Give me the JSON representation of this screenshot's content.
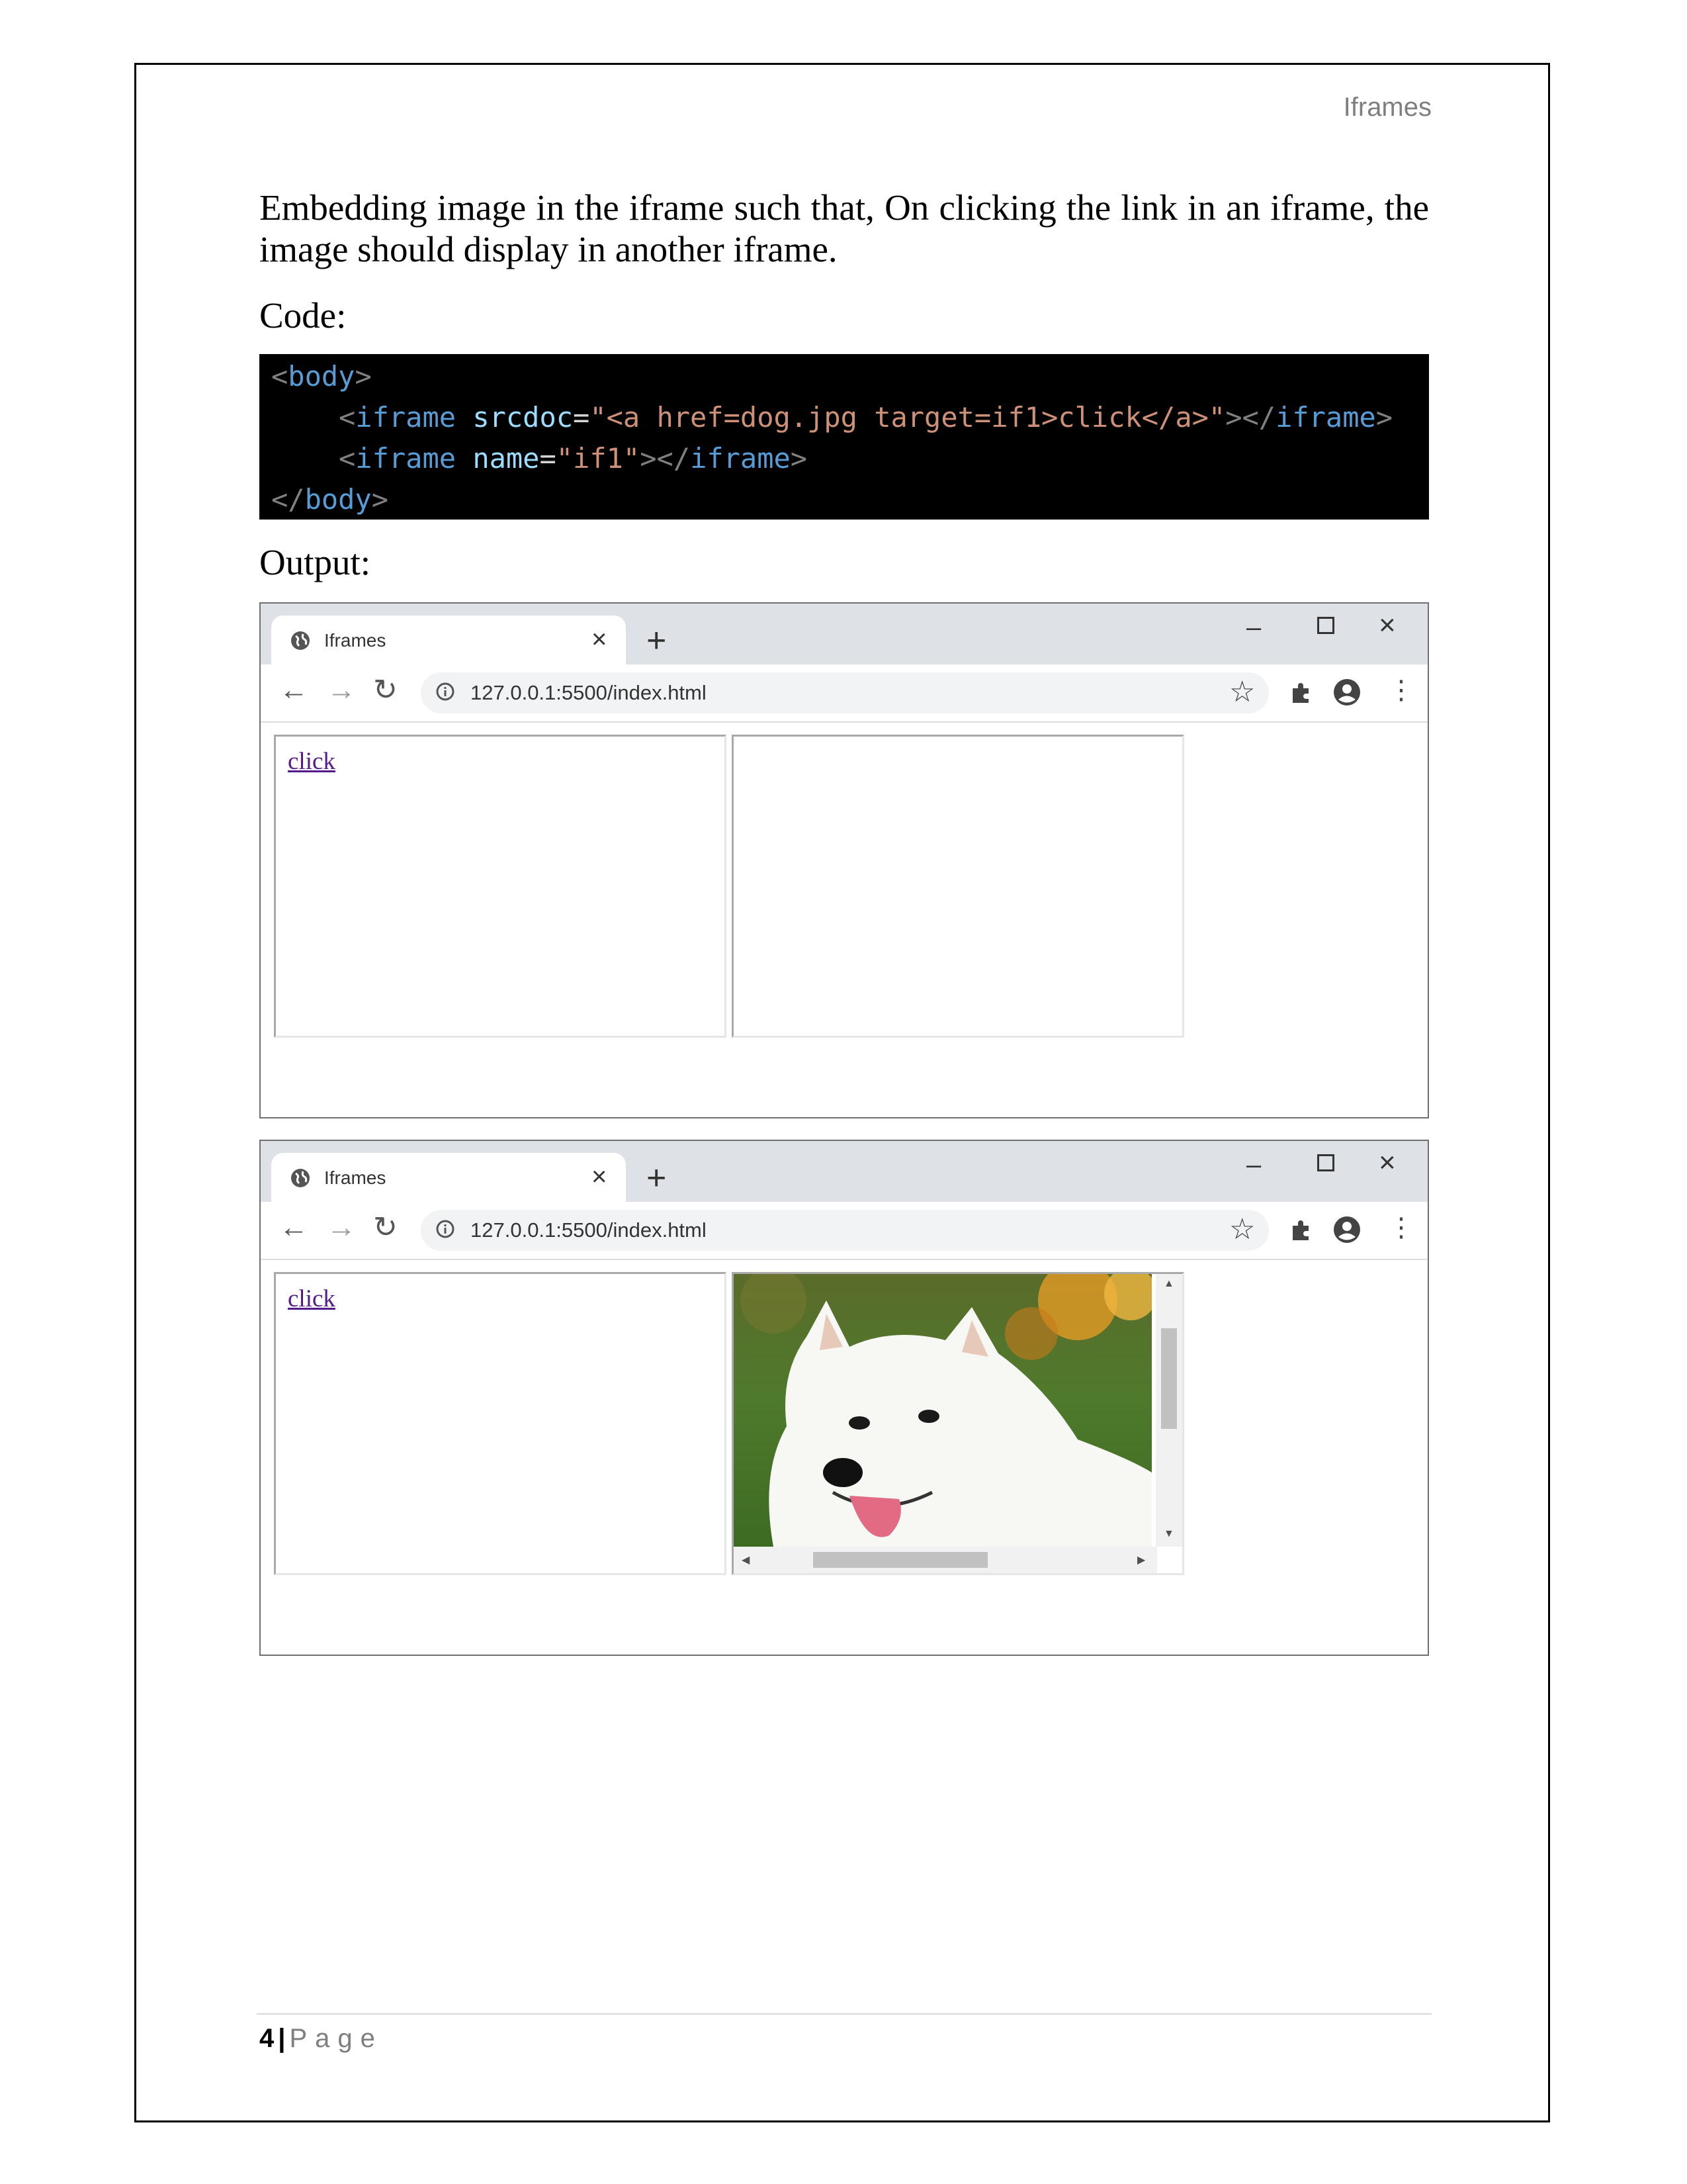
{
  "header": {
    "title": "Iframes"
  },
  "intro": "Embedding image in the iframe such that, On clicking the link in an iframe, the image should display in another iframe.",
  "code_label": "Code:",
  "output_label": "Output:",
  "code": {
    "l1_open": "<",
    "l1_tag": "body",
    "l1_close": ">",
    "l2_open": "<",
    "l2_tag": "iframe",
    "l2_attr": "srcdoc",
    "l2_eq": "=",
    "l2_val": "\"<a href=dog.jpg target=if1>click</a>\"",
    "l2_mid": "></",
    "l2_tag2": "iframe",
    "l2_end": ">",
    "l3_open": "<",
    "l3_tag": "iframe",
    "l3_attr": "name",
    "l3_eq": "=",
    "l3_val": "\"if1\"",
    "l3_mid": "></",
    "l3_tag2": "iframe",
    "l3_end": ">",
    "l4_open": "</",
    "l4_tag": "body",
    "l4_close": ">"
  },
  "browser": {
    "tab_title": "Iframes",
    "tab_close": "×",
    "new_tab": "+",
    "minimize": "–",
    "close": "×",
    "url": "127.0.0.1:5500/index.html",
    "back": "←",
    "forward": "→",
    "reload": "↻",
    "star": "☆",
    "menu": "⋮",
    "link_text": "click"
  },
  "footer": {
    "page_number": "4",
    "separator": "|",
    "page_word": "Page"
  },
  "colors": {
    "code_bg": "#000000",
    "tag": "#569cd6",
    "attr": "#9cdcfe",
    "string": "#ce9178",
    "link": "#551a8b"
  }
}
